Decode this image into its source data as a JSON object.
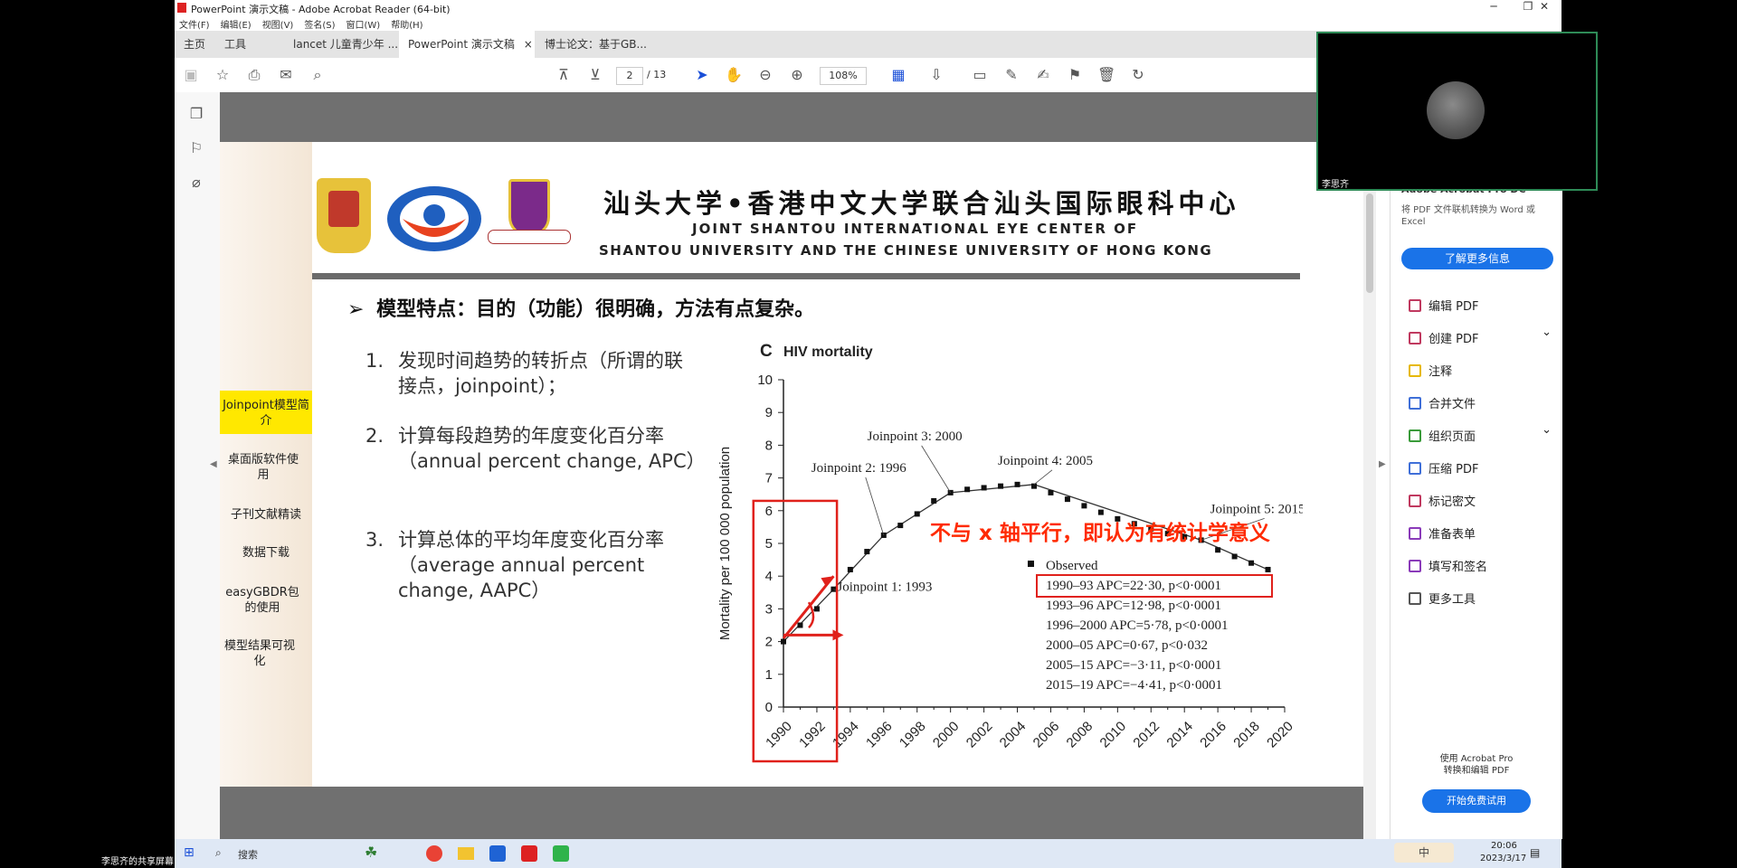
{
  "window": {
    "title": "PowerPoint 演示文稿 - Adobe Acrobat Reader (64-bit)",
    "menus": [
      "文件(F)",
      "编辑(E)",
      "视图(V)",
      "签名(S)",
      "窗口(W)",
      "帮助(H)"
    ],
    "controls": {
      "minimize": "─",
      "restore": "❐",
      "close": "✕"
    }
  },
  "tabs": {
    "home": "主页",
    "tools": "工具",
    "doc1": "lancet 儿童青少年 ...",
    "doc2": "PowerPoint 演示文稿",
    "doc2_close": "×",
    "doc3": "博士论文：基于GB..."
  },
  "toolbar": {
    "page_current": "2",
    "page_total": "/ 13",
    "zoom": "108%"
  },
  "slide": {
    "title_cn": "汕头大学•香港中文大学联合汕头国际眼科中心",
    "title_en1": "JOINT SHANTOU INTERNATIONAL EYE CENTER  OF",
    "title_en2": "SHANTOU UNIVERSITY AND THE CHINESE UNIVERSITY OF HONG KONG",
    "side_menu": [
      {
        "label": "Joinpoint模型简介",
        "active": true
      },
      {
        "label": "桌面版软件使用",
        "active": false
      },
      {
        "label": "子刊文献精读",
        "active": false
      },
      {
        "label": "数据下载",
        "active": false
      },
      {
        "label": "easyGBDR包的使用",
        "active": false
      },
      {
        "label": "模型结果可视化",
        "active": false
      }
    ],
    "heading": "模型特点：目的（功能）很明确，方法有点复杂。",
    "heading_marker": "➢",
    "items": [
      {
        "num": "1.",
        "text": "发现时间趋势的转折点（所谓的联接点，joinpoint）；"
      },
      {
        "num": "2.",
        "text": "计算每段趋势的年度变化百分率（annual percent change, APC）"
      },
      {
        "num": "3.",
        "text": "计算总体的平均年度变化百分率（average annual percent change, AAPC）"
      }
    ],
    "annotation": "不与 x 轴平行，即认为有统计学意义"
  },
  "chart_data": {
    "type": "line",
    "panel_letter": "C",
    "title": "HIV mortality",
    "ylabel": "Mortality per 100 000 population",
    "xlabel": "",
    "ylim": [
      0,
      10
    ],
    "xlim": [
      1990,
      2020
    ],
    "xticks": [
      "1990",
      "1992",
      "1994",
      "1996",
      "1998",
      "2000",
      "2002",
      "2004",
      "2006",
      "2008",
      "2010",
      "2012",
      "2014",
      "2016",
      "2018",
      "2020"
    ],
    "yticks": [
      "0",
      "1",
      "2",
      "3",
      "4",
      "5",
      "6",
      "7",
      "8",
      "9",
      "10"
    ],
    "observed": {
      "x": [
        1990,
        1991,
        1992,
        1993,
        1994,
        1995,
        1996,
        1997,
        1998,
        1999,
        2000,
        2001,
        2002,
        2003,
        2004,
        2005,
        2006,
        2007,
        2008,
        2009,
        2010,
        2011,
        2012,
        2013,
        2014,
        2015,
        2016,
        2017,
        2018,
        2019
      ],
      "y": [
        2.0,
        2.5,
        3.0,
        3.6,
        4.2,
        4.75,
        5.25,
        5.55,
        5.9,
        6.3,
        6.55,
        6.65,
        6.7,
        6.75,
        6.8,
        6.75,
        6.55,
        6.35,
        6.15,
        5.95,
        5.75,
        5.6,
        5.45,
        5.3,
        5.2,
        5.1,
        4.8,
        4.6,
        4.4,
        4.2
      ]
    },
    "fitted": {
      "x": [
        1990,
        1993,
        1996,
        2000,
        2005,
        2015,
        2019
      ],
      "y": [
        2.0,
        3.6,
        5.25,
        6.55,
        6.8,
        5.1,
        4.2
      ]
    },
    "joinpoints": [
      {
        "label": "Joinpoint 1: 1993",
        "x": 1993,
        "y": 3.6
      },
      {
        "label": "Joinpoint 2: 1996",
        "x": 1996,
        "y": 5.25
      },
      {
        "label": "Joinpoint 3: 2000",
        "x": 2000,
        "y": 6.55
      },
      {
        "label": "Joinpoint 4: 2005",
        "x": 2005,
        "y": 6.8
      },
      {
        "label": "Joinpoint 5: 2015",
        "x": 2015,
        "y": 5.1
      }
    ],
    "legend": {
      "observed_label": "Observed",
      "entries": [
        "1990–93 APC=22·30, p<0·0001",
        "1993–96 APC=12·98, p<0·0001",
        "1996–2000 APC=5·78, p<0·0001",
        "2000–05 APC=0·67, p<0·032",
        "2005–15 APC=−3·11, p<0·0001",
        "2015–19 APC=−4·41, p<0·0001"
      ],
      "highlighted": 0
    }
  },
  "right_panel": {
    "header": "Adobe Acrobat Pro DC",
    "desc": "将 PDF 文件联机转换为 Word 或 Excel",
    "learn_more": "了解更多信息",
    "tools": [
      {
        "label": "编辑 PDF",
        "icon": "edit-pdf-icon",
        "expand": ""
      },
      {
        "label": "创建 PDF",
        "icon": "create-pdf-icon",
        "expand": "⌄"
      },
      {
        "label": "注释",
        "icon": "comment-icon",
        "expand": ""
      },
      {
        "label": "合并文件",
        "icon": "combine-icon",
        "expand": ""
      },
      {
        "label": "组织页面",
        "icon": "organize-icon",
        "expand": "⌄"
      },
      {
        "label": "压缩 PDF",
        "icon": "compress-icon",
        "expand": ""
      },
      {
        "label": "标记密文",
        "icon": "redact-icon",
        "expand": ""
      },
      {
        "label": "准备表单",
        "icon": "form-icon",
        "expand": ""
      },
      {
        "label": "填写和签名",
        "icon": "sign-icon",
        "expand": ""
      },
      {
        "label": "更多工具",
        "icon": "more-tools-icon",
        "expand": ""
      }
    ],
    "promo1": "使用 Acrobat Pro",
    "promo2": "转换和编辑 PDF",
    "trial_button": "开始免费试用"
  },
  "webcam": {
    "name": "李思齐"
  },
  "screen_share_label": "李思齐的共享屏幕",
  "taskbar": {
    "search": "搜索",
    "ime": "中",
    "time": "20:06",
    "date": "2023/3/17"
  },
  "colors": {
    "accent_blue": "#1a73e8",
    "annotation_red": "#ff2a00",
    "side_active": "#ffe800"
  }
}
